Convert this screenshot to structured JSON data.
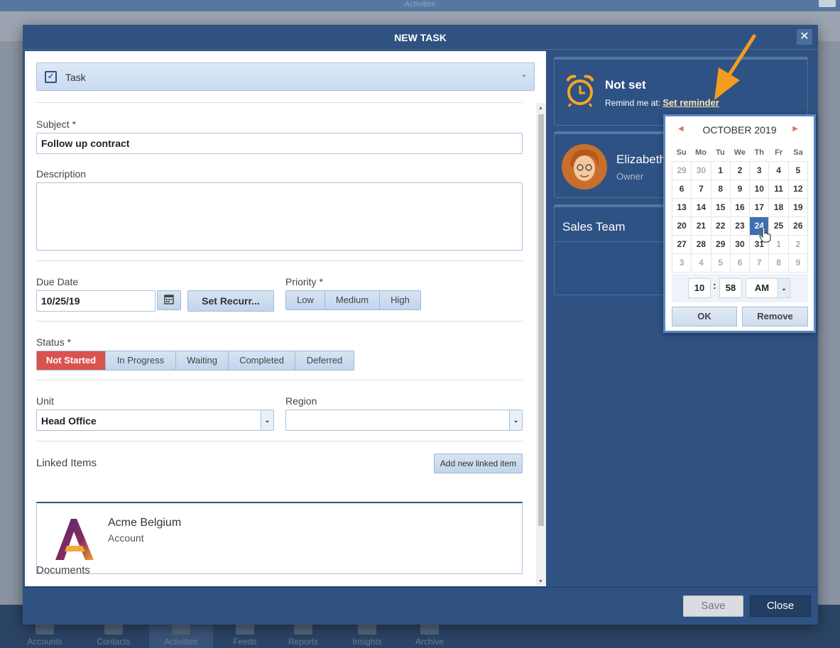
{
  "background": {
    "top_title": "Activities",
    "nav": [
      {
        "label": "Accounts"
      },
      {
        "label": "Contacts"
      },
      {
        "label": "Activities"
      },
      {
        "label": "Feeds"
      },
      {
        "label": "Reports"
      },
      {
        "label": "Insights"
      },
      {
        "label": "Archive"
      }
    ]
  },
  "modal": {
    "title": "NEW TASK",
    "close_glyph": "✕"
  },
  "form": {
    "type_label": "Task",
    "subject_label": "Subject *",
    "subject_value": "Follow up contract",
    "description_label": "Description",
    "description_value": "",
    "due_date_label": "Due Date",
    "due_date_value": "10/25/19",
    "set_recurrence_label": "Set Recurr...",
    "priority_label": "Priority *",
    "priority_options": [
      "Low",
      "Medium",
      "High"
    ],
    "status_label": "Status *",
    "status_options": [
      "Not Started",
      "In Progress",
      "Waiting",
      "Completed",
      "Deferred"
    ],
    "status_selected": "Not Started",
    "unit_label": "Unit",
    "unit_value": "Head Office",
    "region_label": "Region",
    "region_value": "",
    "linked_items_label": "Linked Items",
    "add_linked_label": "Add new linked item",
    "linked_item": {
      "name": "Acme Belgium",
      "type": "Account"
    },
    "documents_label": "Documents"
  },
  "reminder": {
    "status": "Not set",
    "remind_prefix": "Remind me at:",
    "set_link": "Set reminder"
  },
  "owner": {
    "name": "Elizabeth",
    "role": "Owner"
  },
  "team": {
    "name": "Sales Team"
  },
  "calendar": {
    "month_label": "OCTOBER 2019",
    "prev_glyph": "◀",
    "next_glyph": "▶",
    "days_of_week": [
      "Su",
      "Mo",
      "Tu",
      "We",
      "Th",
      "Fr",
      "Sa"
    ],
    "weeks": [
      [
        "29",
        "30",
        "1",
        "2",
        "3",
        "4",
        "5"
      ],
      [
        "6",
        "7",
        "8",
        "9",
        "10",
        "11",
        "12"
      ],
      [
        "13",
        "14",
        "15",
        "16",
        "17",
        "18",
        "19"
      ],
      [
        "20",
        "21",
        "22",
        "23",
        "24",
        "25",
        "26"
      ],
      [
        "27",
        "28",
        "29",
        "30",
        "31",
        "1",
        "2"
      ],
      [
        "3",
        "4",
        "5",
        "6",
        "7",
        "8",
        "9"
      ]
    ],
    "selected_day": "24",
    "hour": "10",
    "minute": "58",
    "ampm": "AM",
    "ok_label": "OK",
    "remove_label": "Remove"
  },
  "footer": {
    "save_label": "Save",
    "close_label": "Close"
  },
  "colors": {
    "accent": "#2f5282",
    "status_active": "#d9534f",
    "alarm": "#f5a623",
    "annotation_arrow": "#f39c1f"
  }
}
